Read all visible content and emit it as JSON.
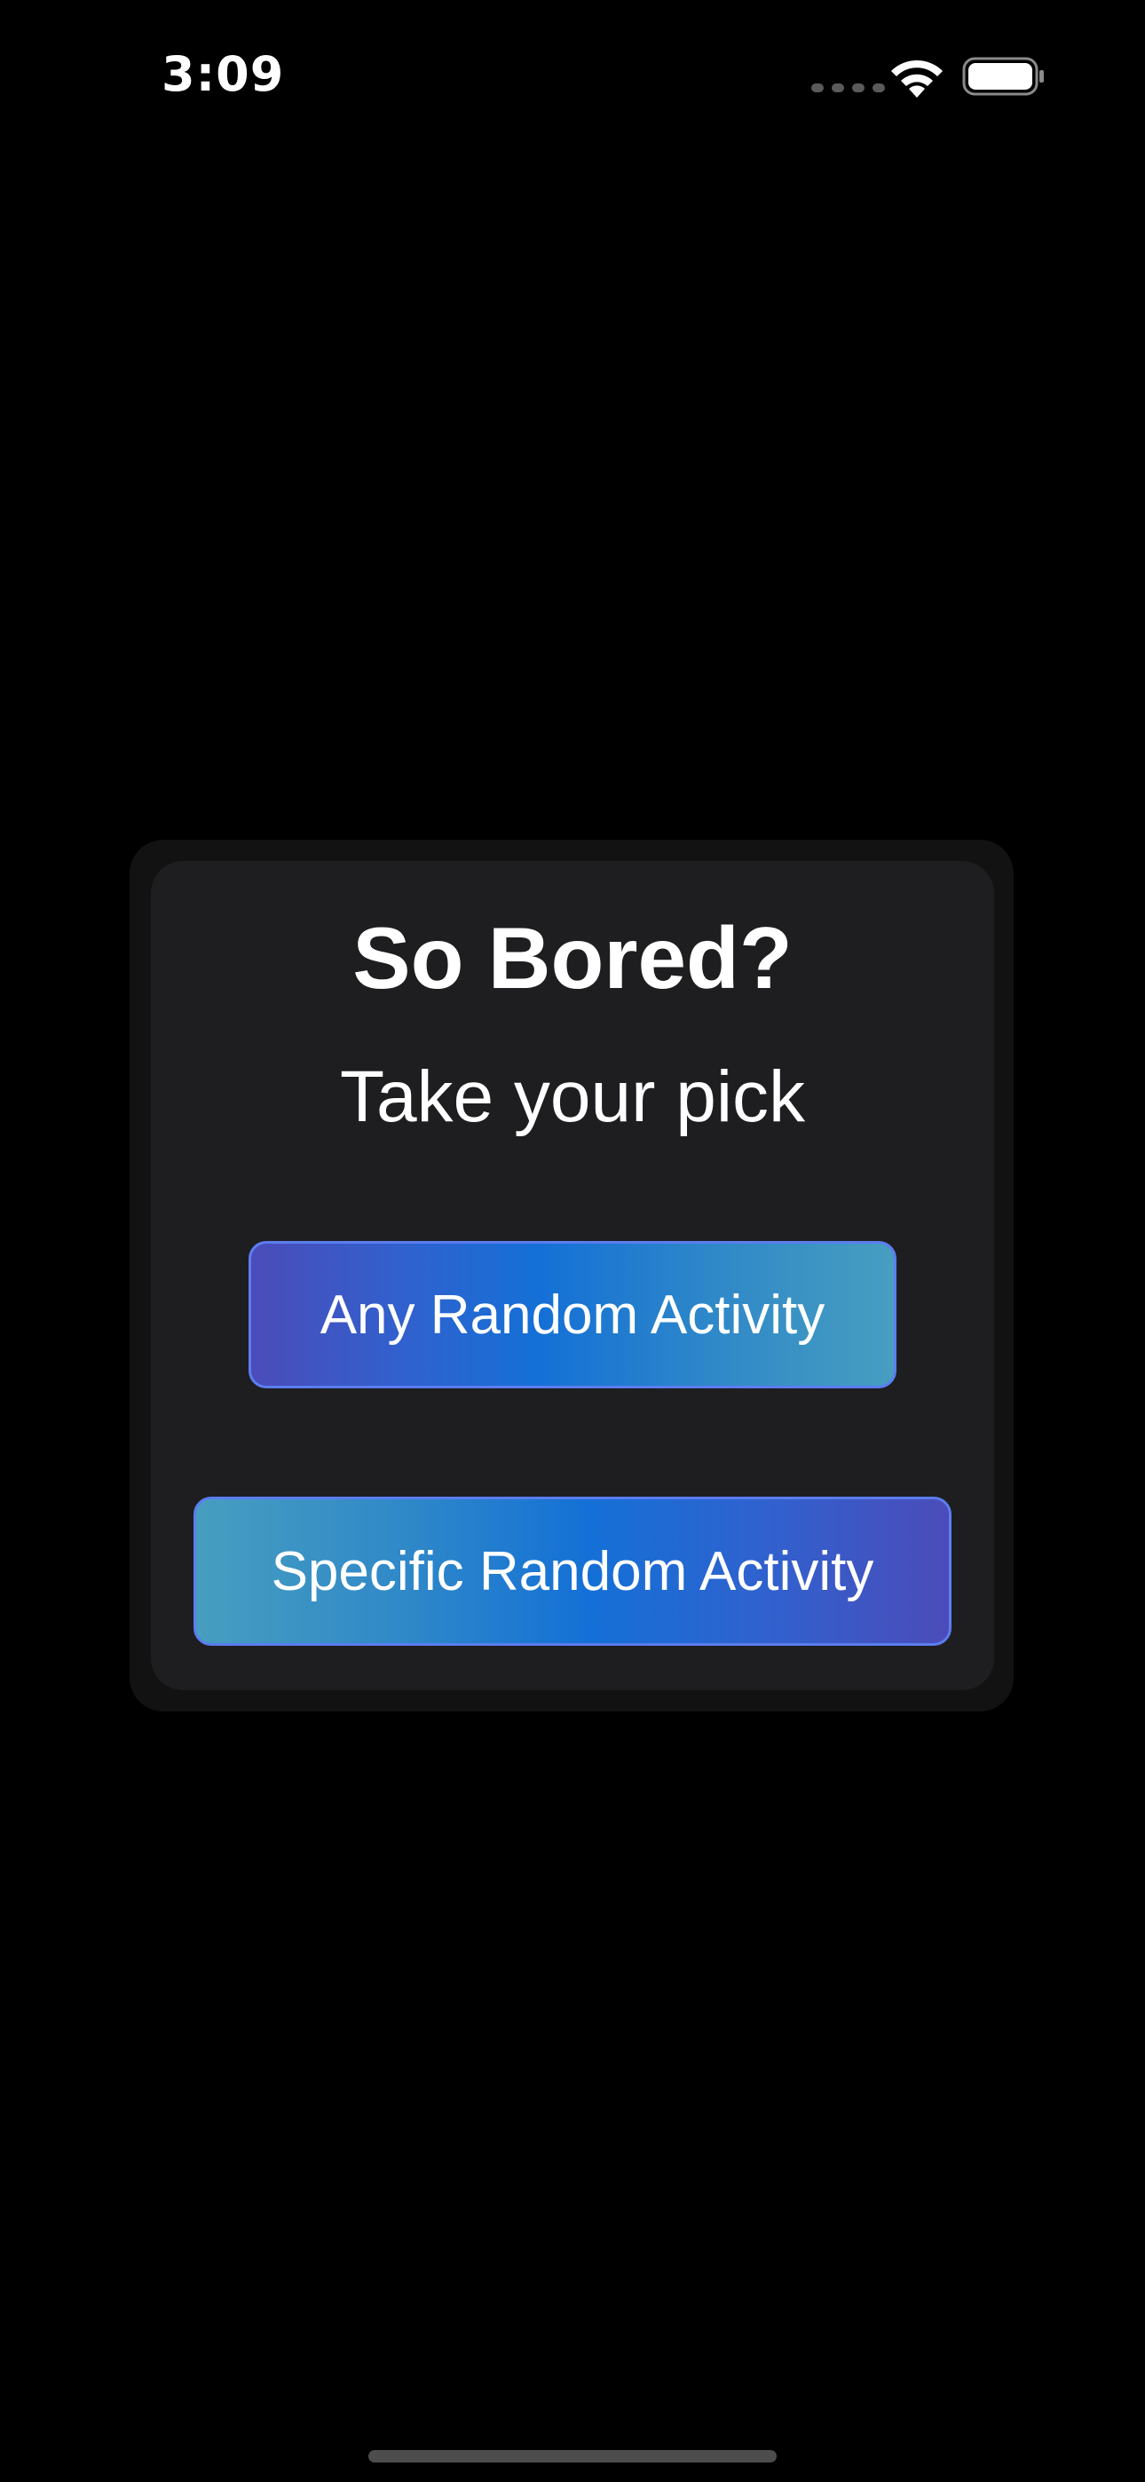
{
  "status_bar": {
    "time": "3:09",
    "icons": [
      "signal-dots-icon",
      "wifi-icon",
      "battery-icon"
    ]
  },
  "card": {
    "title": "So Bored?",
    "subtitle": "Take your pick",
    "buttons": [
      {
        "label": "Any Random Activity"
      },
      {
        "label": "Specific Random Activity"
      }
    ]
  },
  "colors": {
    "background": "#000000",
    "card_outer": "#121212",
    "card_inner": "#1e1e20",
    "gradient_purple": "#4b4cb9",
    "gradient_blue": "#1470d6",
    "gradient_teal": "#479ec0",
    "button_border": "#5b7df0"
  }
}
